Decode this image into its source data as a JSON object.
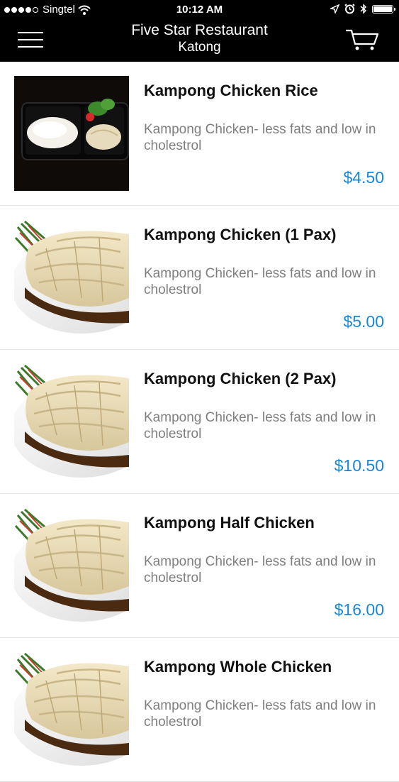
{
  "status_bar": {
    "carrier": "Singtel",
    "time": "10:12 AM"
  },
  "header": {
    "title": "Five Star Restaurant",
    "subtitle": "Katong"
  },
  "icons": {
    "menu": "hamburger-menu-icon",
    "cart": "shopping-cart-icon"
  },
  "colors": {
    "header_bg": "#000000",
    "price": "#1a87d6",
    "description": "#7f7f7f"
  },
  "items": [
    {
      "name": "Kampong Chicken Rice",
      "description": "Kampong Chicken- less fats and low in cholestrol",
      "price": "$4.50",
      "image": "chicken-rice-box"
    },
    {
      "name": "Kampong Chicken (1 Pax)",
      "description": "Kampong Chicken- less fats and low in cholestrol",
      "price": "$5.00",
      "image": "sliced-chicken-plate"
    },
    {
      "name": "Kampong Chicken (2 Pax)",
      "description": "Kampong Chicken- less fats and low in cholestrol",
      "price": "$10.50",
      "image": "sliced-chicken-plate"
    },
    {
      "name": "Kampong Half Chicken",
      "description": "Kampong Chicken- less fats and low in cholestrol",
      "price": "$16.00",
      "image": "sliced-chicken-plate"
    },
    {
      "name": "Kampong Whole Chicken",
      "description": "Kampong Chicken- less fats and low in cholestrol",
      "price": "",
      "image": "sliced-chicken-plate"
    }
  ]
}
